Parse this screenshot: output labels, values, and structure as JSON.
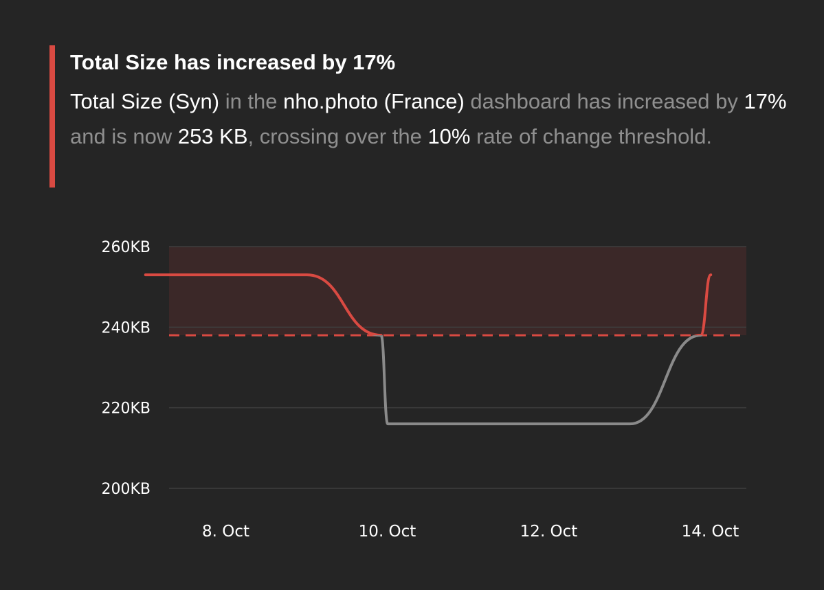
{
  "alert": {
    "title": "Total Size has increased by 17%",
    "body_parts": [
      {
        "text": "Total Size (Syn)",
        "highlight": true
      },
      {
        "text": " in the ",
        "highlight": false
      },
      {
        "text": "nho.photo (France)",
        "highlight": true
      },
      {
        "text": " dashboard has increased by ",
        "highlight": false
      },
      {
        "text": "17%",
        "highlight": true
      },
      {
        "text": " and is now ",
        "highlight": false
      },
      {
        "text": "253 KB",
        "highlight": true
      },
      {
        "text": ", crossing over the ",
        "highlight": false
      },
      {
        "text": "10%",
        "highlight": true
      },
      {
        "text": " rate of change threshold.",
        "highlight": false
      }
    ],
    "accent_color": "#d94a42"
  },
  "chart_data": {
    "type": "line",
    "title": "",
    "xlabel": "",
    "ylabel": "",
    "x_ticks": [
      "8. Oct",
      "10. Oct",
      "12. Oct",
      "14. Oct"
    ],
    "y_ticks": [
      "200KB",
      "220KB",
      "240KB",
      "260KB"
    ],
    "y_tick_values": [
      200,
      220,
      240,
      260
    ],
    "ylim": [
      200,
      260
    ],
    "grid": true,
    "series": [
      {
        "x": [
          "2023-10-07T12:00",
          "2023-10-09T12:00",
          "2023-10-10T10:00",
          "2023-10-10T12:00",
          "2023-10-13T12:00",
          "2023-10-14T09:00",
          "2023-10-14T12:00"
        ],
        "y": [
          253,
          253,
          238,
          216,
          216,
          238,
          253
        ]
      }
    ],
    "threshold": 238,
    "threshold_band": [
      238,
      260
    ],
    "colors": {
      "above_threshold": "#d94a42",
      "below_threshold": "#8a8a8a",
      "threshold_line": "#d94a42",
      "band_fill": "#3b2828",
      "grid": "#3e3e3e"
    }
  }
}
